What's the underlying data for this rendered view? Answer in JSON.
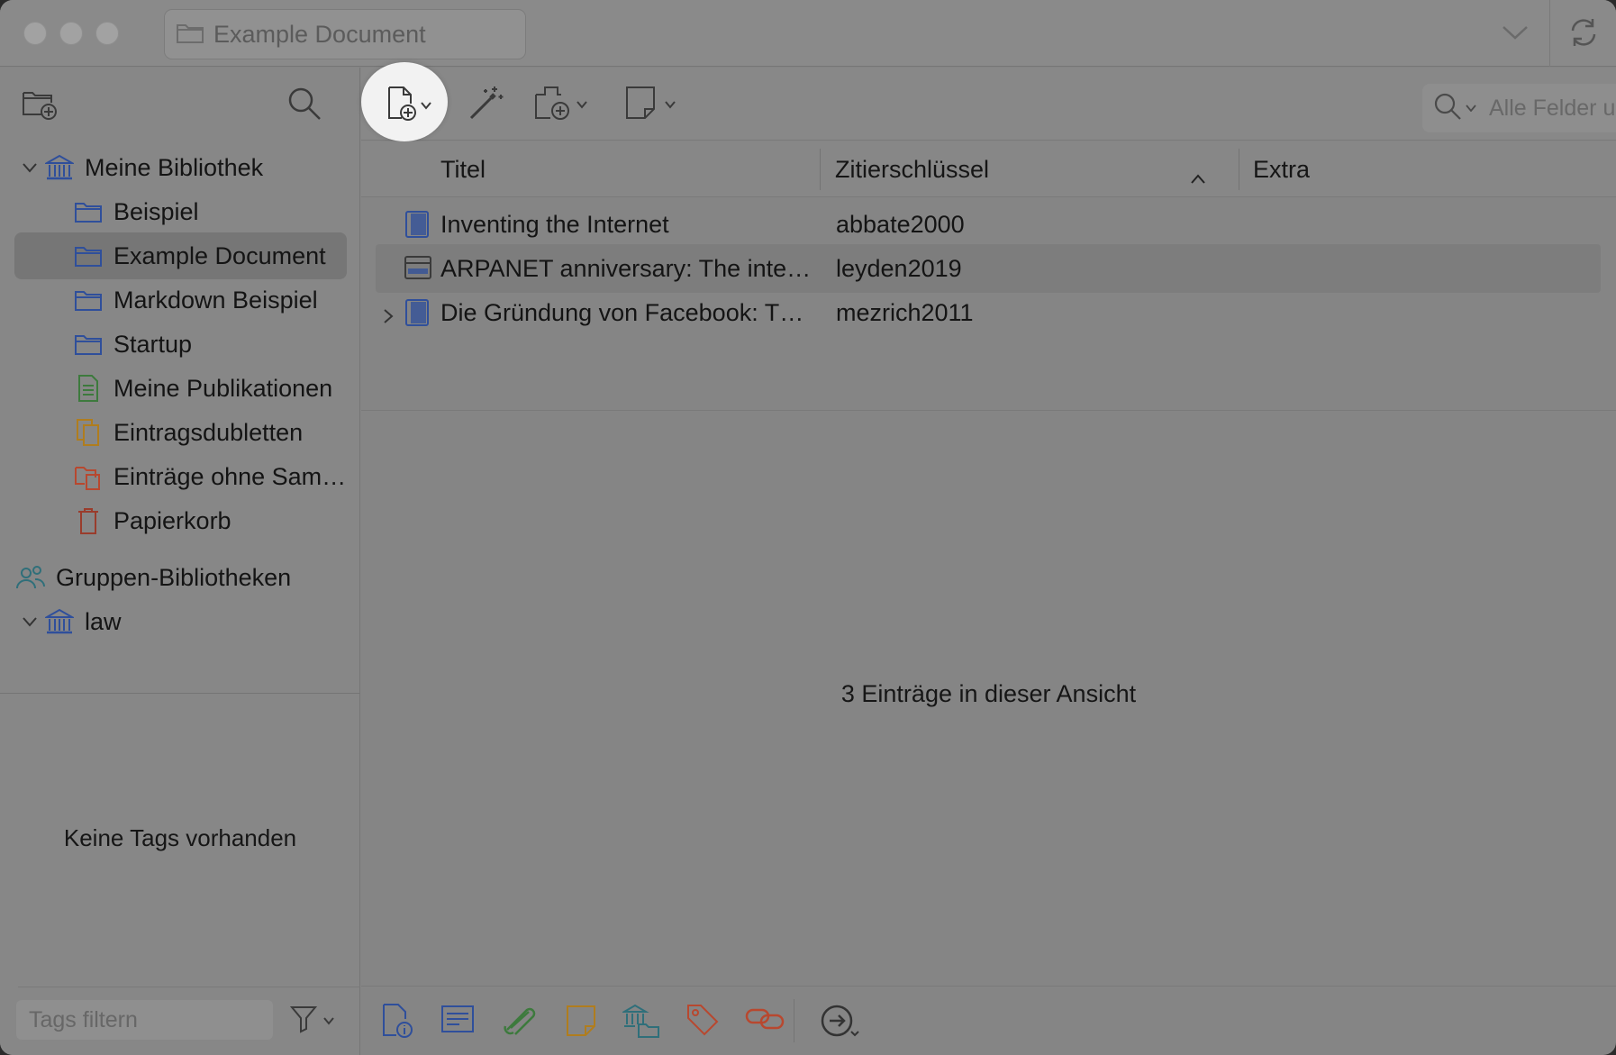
{
  "window": {
    "tab_title": "Example Document"
  },
  "sidebar": {
    "library": {
      "label": "Meine Bibliothek"
    },
    "collections": [
      {
        "label": "Beispiel",
        "icon": "folder-icon"
      },
      {
        "label": "Example Document",
        "icon": "folder-icon",
        "selected": true
      },
      {
        "label": "Markdown Beispiel",
        "icon": "folder-icon"
      },
      {
        "label": "Startup",
        "icon": "folder-icon"
      },
      {
        "label": "Meine Publikationen",
        "icon": "publications-icon"
      },
      {
        "label": "Eintragsdubletten",
        "icon": "duplicates-icon"
      },
      {
        "label": "Einträge ohne Sam…",
        "icon": "unfiled-icon"
      },
      {
        "label": "Papierkorb",
        "icon": "trash-icon"
      }
    ],
    "groups": {
      "label": "Gruppen-Bibliotheken"
    },
    "group_libraries": [
      {
        "label": "law"
      }
    ],
    "tags": {
      "empty_label": "Keine Tags vorhanden",
      "filter_placeholder": "Tags filtern"
    }
  },
  "toolbar": {
    "search_placeholder": "Alle Felder und Tags"
  },
  "table": {
    "columns": [
      {
        "label": "Titel"
      },
      {
        "label": "Zitierschlüssel",
        "sorted": "ascending"
      },
      {
        "label": "Extra"
      }
    ],
    "rows": [
      {
        "title": "Inventing the Internet",
        "key": "abbate2000",
        "type": "book-icon",
        "has_children": false
      },
      {
        "title": "ARPANET anniversary: The inte…",
        "key": "leyden2019",
        "type": "webpage-icon",
        "has_children": false
      },
      {
        "title": "Die Gründung von Facebook: T…",
        "key": "mezrich2011",
        "type": "book-icon",
        "has_children": true
      }
    ],
    "count_label": "3 Einträge in dieser Ansicht"
  },
  "colors": {
    "folder": "#2f4f9b",
    "publications": "#3d7a3d",
    "duplicates": "#b07d1e",
    "unfiled": "#b8482f",
    "trash": "#9a3c2c",
    "groups": "#2f6f7a"
  }
}
